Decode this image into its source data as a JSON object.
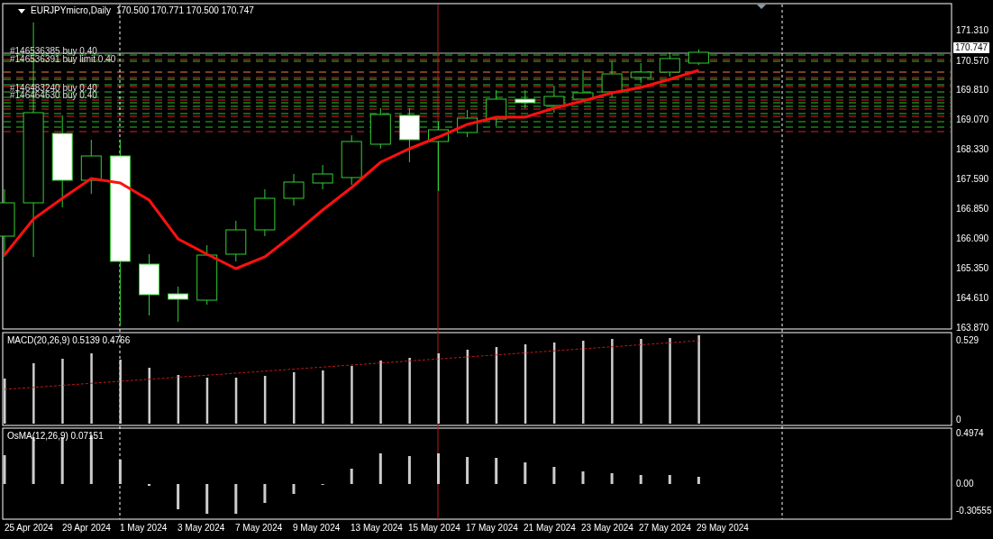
{
  "chart": {
    "symbol": "EURJPYmicro,Daily",
    "ohlc": "170.500 170.771 170.500 170.747",
    "current_price": "170.747",
    "price_axis": [
      "171.310",
      "170.570",
      "169.810",
      "169.070",
      "168.330",
      "167.590",
      "166.850",
      "166.090",
      "165.350",
      "164.610",
      "163.870"
    ],
    "order_labels": [
      "#146536385 buy 0.40",
      "#146536391 buy limit 0.40",
      "#146483240 buy 0.40",
      "#146464630 buy 0.40"
    ]
  },
  "macd": {
    "label": "MACD(20,26,9) 0.5139 0.4766",
    "axis": [
      "0.529",
      "0"
    ]
  },
  "osma": {
    "label": "OsMA(12,26,9) 0.07151",
    "axis": [
      "0.4974",
      "0.00",
      "-0.30555"
    ]
  },
  "time_axis": [
    "25 Apr 2024",
    "29 Apr 2024",
    "1 May 2024",
    "3 May 2024",
    "7 May 2024",
    "9 May 2024",
    "13 May 2024",
    "15 May 2024",
    "17 May 2024",
    "21 May 2024",
    "23 May 2024",
    "27 May 2024",
    "29 May 2024"
  ]
}
